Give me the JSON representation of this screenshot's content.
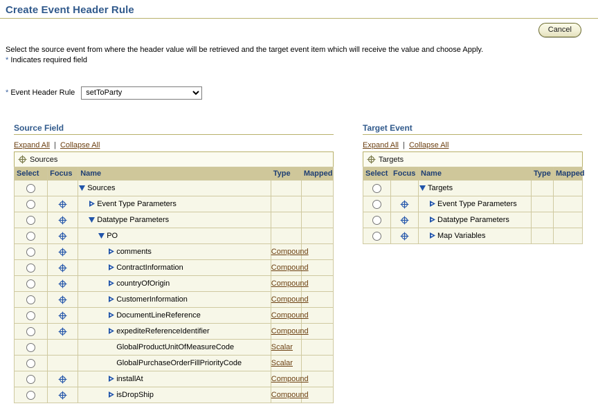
{
  "page": {
    "title": "Create Event Header Rule",
    "instructions": "Select the source event from where the header value will be retrieved and the target event item which will receive the value and choose Apply.",
    "required_note": "Indicates required field",
    "required_star": "*"
  },
  "toolbar": {
    "cancel_label": "Cancel"
  },
  "rule": {
    "label_star": "*",
    "label": "Event Header Rule",
    "selected": "setToParty",
    "options": [
      "setToParty"
    ]
  },
  "colors": {
    "title_blue": "#315a8c",
    "rule_line": "#b8b06a",
    "table_border": "#b8b06a",
    "header_band": "#cfc79a",
    "row_bg": "#f7f7e8",
    "link_brown": "#6b3f10",
    "icon_blue": "#2255aa"
  },
  "source_panel": {
    "section_title": "Source Field",
    "expand_all": "Expand All",
    "collapse_all": "Collapse All",
    "separator": "|",
    "root_label": "Sources",
    "root_icon": "focus-crosshair-icon",
    "columns": [
      "Select",
      "Focus",
      "Name",
      "Type",
      "Mapped"
    ],
    "rows": [
      {
        "name": "Sources",
        "indent": 0,
        "toggle": "expanded",
        "focus": false,
        "type": "",
        "mapped": "",
        "selected": false
      },
      {
        "name": "Event Type Parameters",
        "indent": 1,
        "toggle": "collapsed",
        "focus": true,
        "type": "",
        "mapped": "",
        "selected": false
      },
      {
        "name": "Datatype Parameters",
        "indent": 1,
        "toggle": "expanded",
        "focus": true,
        "type": "",
        "mapped": "",
        "selected": false
      },
      {
        "name": "PO",
        "indent": 2,
        "toggle": "expanded",
        "focus": true,
        "type": "",
        "mapped": "",
        "selected": false
      },
      {
        "name": "comments",
        "indent": 3,
        "toggle": "collapsed",
        "focus": true,
        "type": "Compound",
        "mapped": "",
        "selected": false
      },
      {
        "name": "ContractInformation",
        "indent": 3,
        "toggle": "collapsed",
        "focus": true,
        "type": "Compound",
        "mapped": "",
        "selected": false
      },
      {
        "name": "countryOfOrigin",
        "indent": 3,
        "toggle": "collapsed",
        "focus": true,
        "type": "Compound",
        "mapped": "",
        "selected": false
      },
      {
        "name": "CustomerInformation",
        "indent": 3,
        "toggle": "collapsed",
        "focus": true,
        "type": "Compound",
        "mapped": "",
        "selected": false
      },
      {
        "name": "DocumentLineReference",
        "indent": 3,
        "toggle": "collapsed",
        "focus": true,
        "type": "Compound",
        "mapped": "",
        "selected": false
      },
      {
        "name": "expediteReferenceIdentifier",
        "indent": 3,
        "toggle": "collapsed",
        "focus": true,
        "type": "Compound",
        "mapped": "",
        "selected": false
      },
      {
        "name": "GlobalProductUnitOfMeasureCode",
        "indent": 3,
        "toggle": "none",
        "focus": false,
        "type": "Scalar",
        "mapped": "",
        "selected": false
      },
      {
        "name": "GlobalPurchaseOrderFillPriorityCode",
        "indent": 3,
        "toggle": "none",
        "focus": false,
        "type": "Scalar",
        "mapped": "",
        "selected": false
      },
      {
        "name": "installAt",
        "indent": 3,
        "toggle": "collapsed",
        "focus": true,
        "type": "Compound",
        "mapped": "",
        "selected": false
      },
      {
        "name": "isDropShip",
        "indent": 3,
        "toggle": "collapsed",
        "focus": true,
        "type": "Compound",
        "mapped": "",
        "selected": false
      }
    ]
  },
  "target_panel": {
    "section_title": "Target Event",
    "expand_all": "Expand All",
    "collapse_all": "Collapse All",
    "separator": "|",
    "root_label": "Targets",
    "root_icon": "focus-crosshair-icon",
    "columns": [
      "Select",
      "Focus",
      "Name",
      "Type",
      "Mapped"
    ],
    "rows": [
      {
        "name": "Targets",
        "indent": 0,
        "toggle": "expanded",
        "focus": false,
        "type": "",
        "mapped": "",
        "selected": false
      },
      {
        "name": "Event Type Parameters",
        "indent": 1,
        "toggle": "collapsed",
        "focus": true,
        "type": "",
        "mapped": "",
        "selected": false
      },
      {
        "name": "Datatype Parameters",
        "indent": 1,
        "toggle": "collapsed",
        "focus": true,
        "type": "",
        "mapped": "",
        "selected": false
      },
      {
        "name": "Map Variables",
        "indent": 1,
        "toggle": "collapsed",
        "focus": true,
        "type": "",
        "mapped": "",
        "selected": false
      }
    ]
  }
}
